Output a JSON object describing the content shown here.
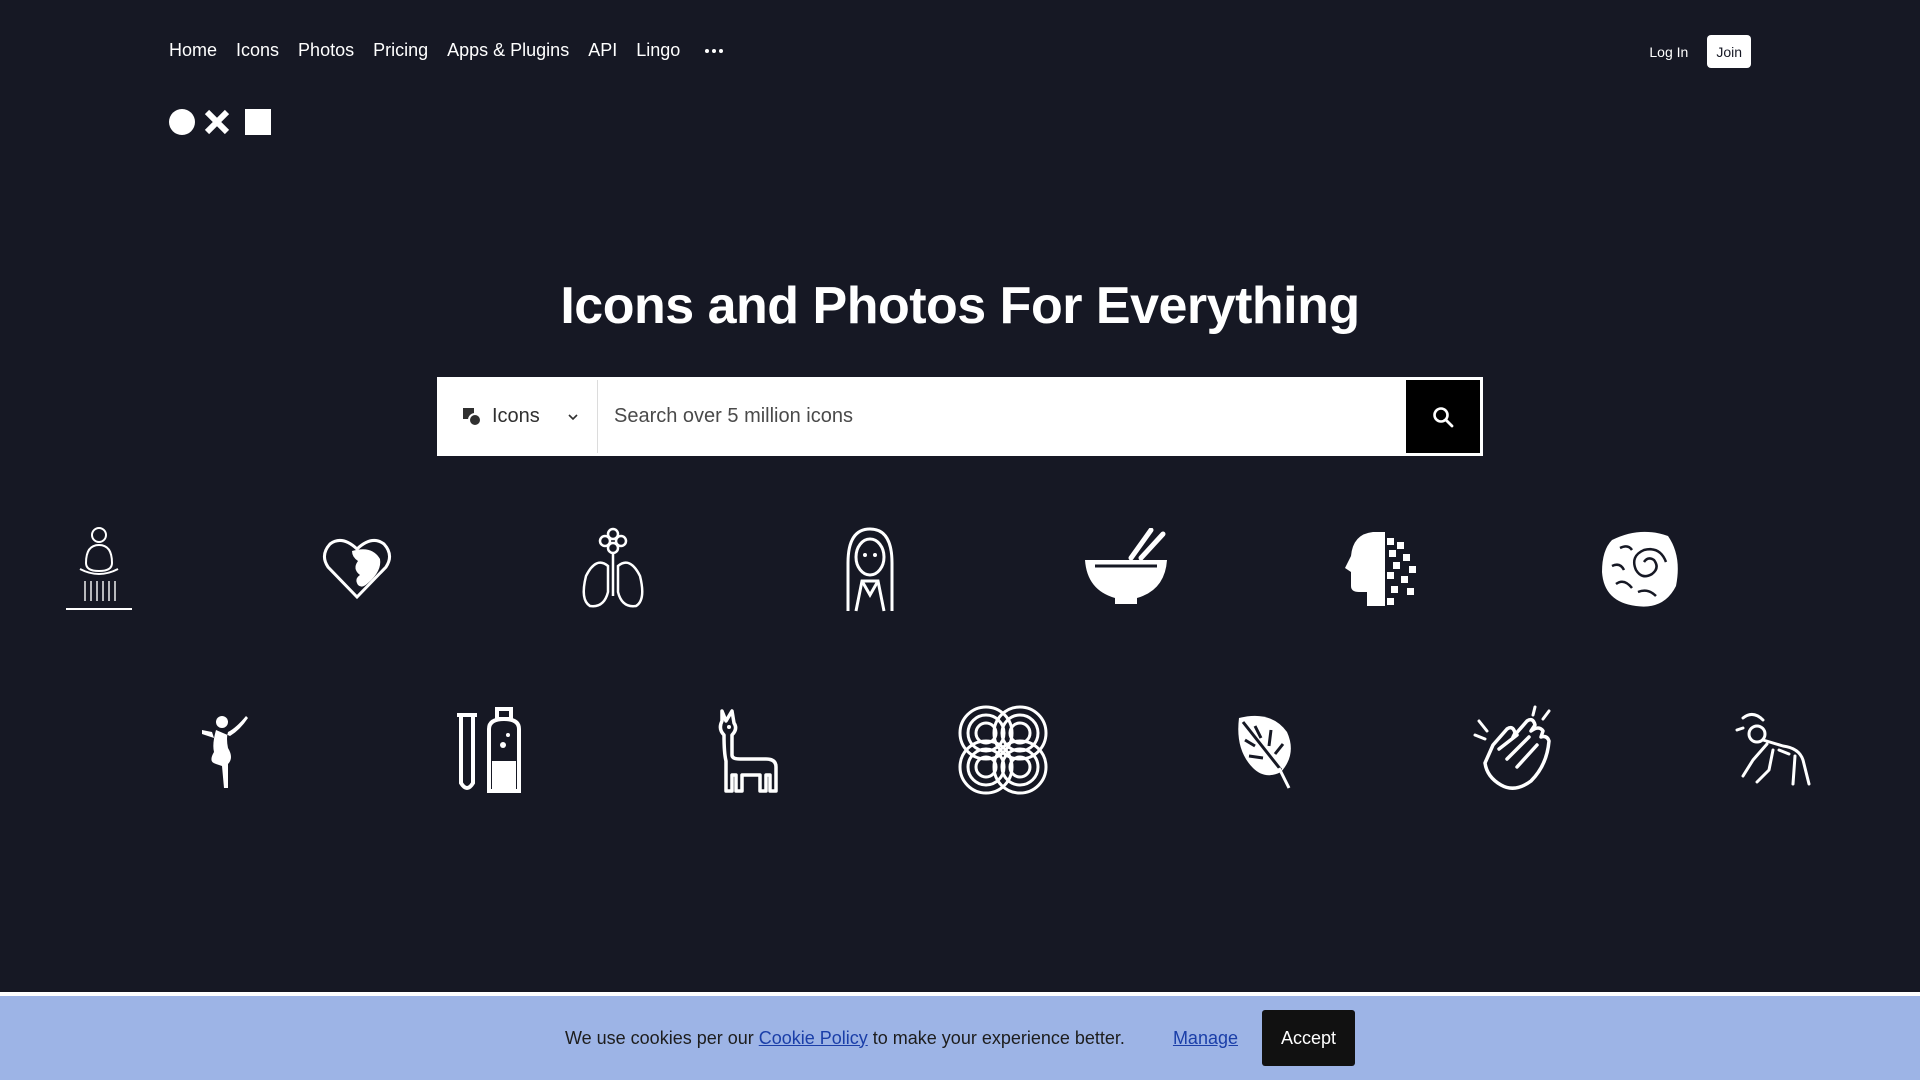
{
  "nav": {
    "items": [
      {
        "label": "Home"
      },
      {
        "label": "Icons"
      },
      {
        "label": "Photos"
      },
      {
        "label": "Pricing"
      },
      {
        "label": "Apps & Plugins"
      },
      {
        "label": "API"
      },
      {
        "label": "Lingo"
      }
    ],
    "more_icon": "more-horizontal-icon"
  },
  "auth": {
    "login_label": "Log In",
    "join_label": "Join"
  },
  "hero": {
    "title": "Icons and Photos For Everything"
  },
  "search": {
    "type_label": "Icons",
    "placeholder": "Search over 5 million icons",
    "value": ""
  },
  "icon_grid": {
    "row1": [
      "meditation-shower-icon",
      "heart-face-icon",
      "lungs-flower-icon",
      "woman-portrait-icon",
      "bowl-chopsticks-icon",
      "pixel-head-icon",
      "spiral-fossil-icon"
    ],
    "row2": [
      "dancer-icon",
      "test-tube-bottle-icon",
      "llama-icon",
      "interlaced-pattern-icon",
      "monstera-leaf-icon",
      "clapping-hands-icon",
      "crawling-man-icon"
    ]
  },
  "cookie": {
    "text_before": "We use cookies per our ",
    "policy_link": "Cookie Policy",
    "text_after": " to make your experience better.",
    "manage_label": "Manage",
    "accept_label": "Accept"
  },
  "colors": {
    "background": "#161824",
    "banner": "#9db4e6",
    "link": "#1a3ea8"
  }
}
